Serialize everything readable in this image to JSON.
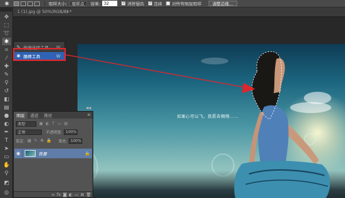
{
  "options_bar": {
    "tool_icon": "magic-wand-icon",
    "sample_size_label": "取样大小:",
    "sample_size_value": "取样点",
    "tolerance_label": "容差:",
    "tolerance_value": "32",
    "antialias_label": "消除锯齿",
    "contiguous_label": "连续",
    "sample_all_layers_label": "对所有图层取样",
    "refine_edge_button": "调整边缘..."
  },
  "document": {
    "tab_title": "1 (1).jpg @ 50%(RGB/8) *",
    "close_glyph": "×"
  },
  "canvas": {
    "caption": "如果心可以飞，我愿去翱翔……"
  },
  "tool_flyout": {
    "items": [
      {
        "label": "快速选择工具",
        "shortcut": "W",
        "icon": "quick-select-icon"
      },
      {
        "label": "魔棒工具",
        "shortcut": "W",
        "icon": "magic-wand-icon"
      }
    ]
  },
  "layers_panel": {
    "tabs": [
      "图层",
      "通道",
      "路径"
    ],
    "filter_label": "类型",
    "blend_mode": "正常",
    "opacity_label": "不透明度:",
    "opacity_value": "100%",
    "lock_label": "锁定:",
    "fill_label": "填充:",
    "fill_value": "100%",
    "layer_name": "背景"
  },
  "colors": {
    "highlight_red": "#e0262c",
    "selection_blue": "#2f63b5"
  }
}
